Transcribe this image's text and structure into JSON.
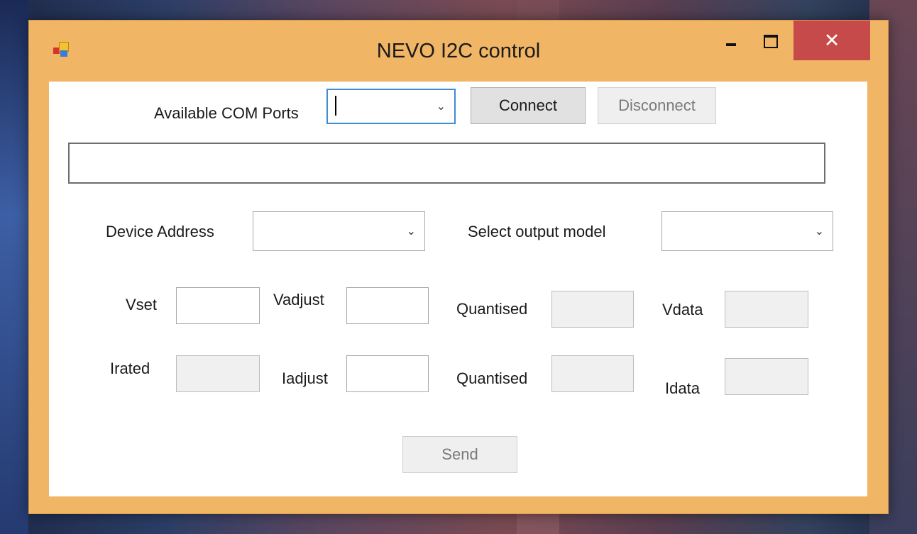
{
  "window": {
    "title": "NEVO I2C control",
    "minimize_symbol": "",
    "maximize_symbol": "",
    "close_symbol": "✕"
  },
  "com": {
    "label": "Available COM Ports",
    "selected": "",
    "connect_label": "Connect",
    "disconnect_label": "Disconnect"
  },
  "status": {
    "text": ""
  },
  "device": {
    "address_label": "Device Address",
    "address_value": "",
    "output_model_label": "Select output model",
    "output_model_value": ""
  },
  "voltage": {
    "vset_label": "Vset",
    "vset_value": "",
    "vadjust_label": "Vadjust",
    "vadjust_value": "",
    "quantised_label": "Quantised",
    "quantised_value": "",
    "vdata_label": "Vdata",
    "vdata_value": ""
  },
  "current": {
    "irated_label": "Irated",
    "irated_value": "",
    "iadjust_label": "Iadjust",
    "iadjust_value": "",
    "quantised_label": "Quantised",
    "quantised_value": "",
    "idata_label": "Idata",
    "idata_value": ""
  },
  "send_label": "Send",
  "icons": {
    "dropdown": "chevron-down-icon",
    "app": "app-icon"
  },
  "colors": {
    "title_bar": "#f0b565",
    "close_button": "#c74a4b",
    "focus_border": "#3c8cd6"
  }
}
